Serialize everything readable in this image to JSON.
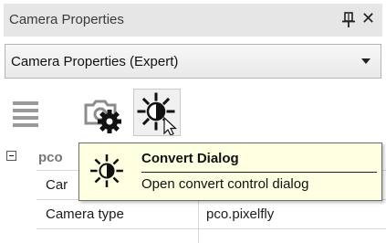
{
  "panel": {
    "title": "Camera Properties",
    "pin_icon": "pin-icon",
    "close_label": "✕"
  },
  "selector": {
    "selected": "Camera Properties (Expert)",
    "arrow_icon": "chevron-down-icon"
  },
  "toolbar": {
    "buttons": [
      {
        "icon": "list-icon"
      },
      {
        "icon": "camera-settings-icon"
      },
      {
        "icon": "brightness-contrast-icon",
        "state": "hovered"
      }
    ]
  },
  "properties": {
    "group_label": "pco",
    "rows": [
      {
        "key": "Car",
        "value": ""
      },
      {
        "key": "Camera type",
        "value": "pco.pixelfly"
      }
    ]
  },
  "tooltip": {
    "title": "Convert Dialog",
    "description": "Open convert control dialog",
    "icon": "brightness-contrast-icon"
  }
}
